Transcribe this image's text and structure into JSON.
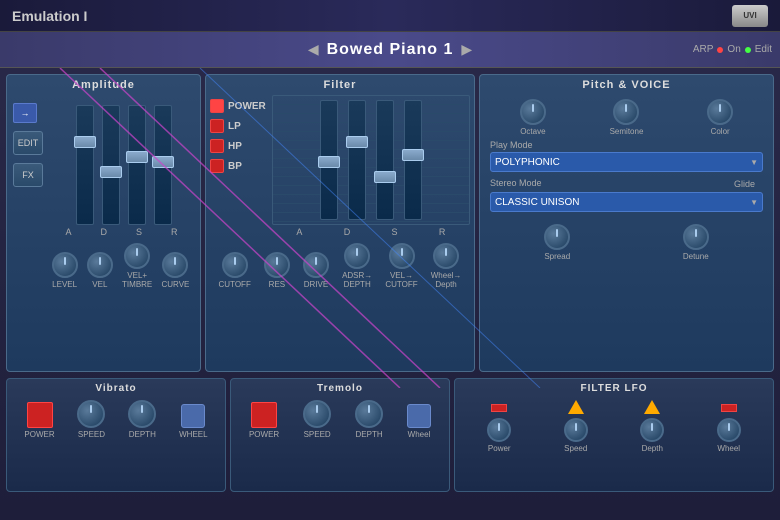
{
  "header": {
    "title": "Emulation I",
    "logo": "UVI"
  },
  "preset": {
    "name": "Bowed Piano 1",
    "prev_label": "◀",
    "next_label": "▶"
  },
  "arp": {
    "label": "ARP",
    "on_label": "On",
    "edit_label": "Edit"
  },
  "amplitude": {
    "title": "Amplitude",
    "sliders": [
      "A",
      "D",
      "S",
      "R"
    ],
    "knobs": [
      "LEVEL",
      "VEL",
      "VEL+TIMBRE",
      "CURVE"
    ],
    "edit_label": "EDIT",
    "fx_label": "FX"
  },
  "filter": {
    "title": "Filter",
    "power_label": "POWER",
    "lp_label": "LP",
    "hp_label": "HP",
    "bp_label": "BP",
    "sliders": [
      "A",
      "D",
      "S",
      "R"
    ],
    "knobs": [
      "CUTOFF",
      "RES",
      "DRIVE",
      "ADSR→DEPTH",
      "VEL→CUTOFF",
      "Wheel→Depth"
    ]
  },
  "pitch_voice": {
    "title": "Pitch & VOICE",
    "knobs": [
      "Octave",
      "Semitone",
      "Color"
    ],
    "play_mode_label": "Play Mode",
    "play_mode_value": "POLYPHONIC",
    "stereo_mode_label": "Stereo Mode",
    "stereo_mode_value": "CLASSIC UNISON",
    "glide_label": "Glide",
    "knobs2": [
      "Spread",
      "Detune"
    ]
  },
  "vibrato": {
    "title": "Vibrato",
    "controls": [
      "POWER",
      "SPEED",
      "DEPTH",
      "WHEEL"
    ]
  },
  "tremolo": {
    "title": "Tremolo",
    "controls": [
      "POWER",
      "SPEED",
      "DEPTH",
      "Wheel"
    ]
  },
  "filter_lfo": {
    "title": "FILTER LFO",
    "controls": [
      "Power",
      "Speed",
      "Depth",
      "Wheel"
    ]
  }
}
